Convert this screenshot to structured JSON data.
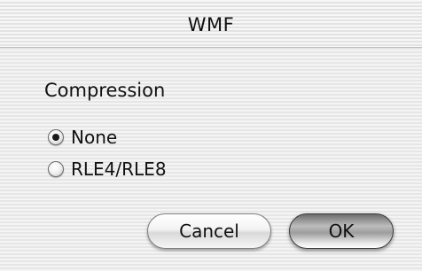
{
  "window": {
    "title": "WMF"
  },
  "compression": {
    "label": "Compression",
    "options": [
      {
        "label": "None",
        "checked": true
      },
      {
        "label": "RLE4/RLE8",
        "checked": false
      }
    ]
  },
  "buttons": {
    "cancel_label": "Cancel",
    "ok_label": "OK"
  }
}
